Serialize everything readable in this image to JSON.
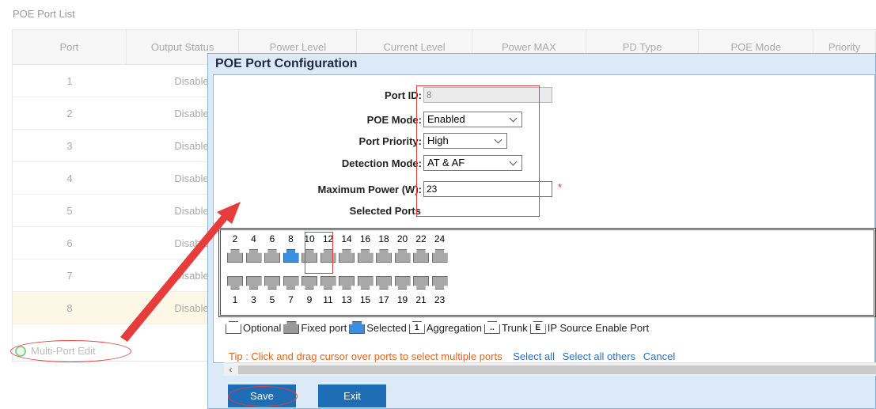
{
  "page": {
    "title": "POE Port List"
  },
  "table": {
    "headers": [
      "Port",
      "Output Status",
      "Power Level",
      "Current Level",
      "Power MAX",
      "PD Type",
      "POE Mode",
      "Priority"
    ],
    "rows": [
      {
        "port": "1",
        "status": "Disabled"
      },
      {
        "port": "2",
        "status": "Disabled"
      },
      {
        "port": "3",
        "status": "Disabled"
      },
      {
        "port": "4",
        "status": "Disabled"
      },
      {
        "port": "5",
        "status": "Disabled"
      },
      {
        "port": "6",
        "status": "Disabled"
      },
      {
        "port": "7",
        "status": "Disabled"
      },
      {
        "port": "8",
        "status": "Disabled"
      }
    ]
  },
  "multi_edit": {
    "label": "Multi-Port Edit"
  },
  "dialog": {
    "title": "POE Port Configuration",
    "port_id": {
      "label": "Port ID:",
      "value": "8"
    },
    "poe_mode": {
      "label": "POE Mode:",
      "value": "Enabled"
    },
    "port_priority": {
      "label": "Port Priority:",
      "value": "High"
    },
    "detection_mode": {
      "label": "Detection Mode:",
      "value": "AT & AF"
    },
    "max_power": {
      "label": "Maximum Power (W):",
      "value": "23",
      "required_mark": "*"
    },
    "selected_ports": {
      "label": "Selected Ports"
    },
    "ports_top": [
      "2",
      "4",
      "6",
      "8",
      "10",
      "12",
      "14",
      "16",
      "18",
      "20",
      "22",
      "24"
    ],
    "ports_bottom": [
      "1",
      "3",
      "5",
      "7",
      "9",
      "11",
      "13",
      "15",
      "17",
      "19",
      "21",
      "23"
    ],
    "selected_port": "8",
    "legend": {
      "optional": "Optional",
      "fixed": "Fixed port",
      "selected": "Selected",
      "aggregation": "Aggregation",
      "aggregation_icon": "1",
      "trunk": "Trunk",
      "trunk_icon": "..",
      "ip_source": "IP Source Enable Port",
      "ip_source_icon": "E"
    },
    "tip": {
      "text": "Tip : Click and drag cursor over ports to select multiple ports",
      "select_all": "Select all",
      "select_all_others": "Select all others",
      "cancel": "Cancel"
    },
    "save_label": "Save",
    "exit_label": "Exit"
  },
  "colors": {
    "accent": "#1f6db4",
    "annotation": "#e63c3c",
    "selected_port": "#3b8ee0"
  }
}
